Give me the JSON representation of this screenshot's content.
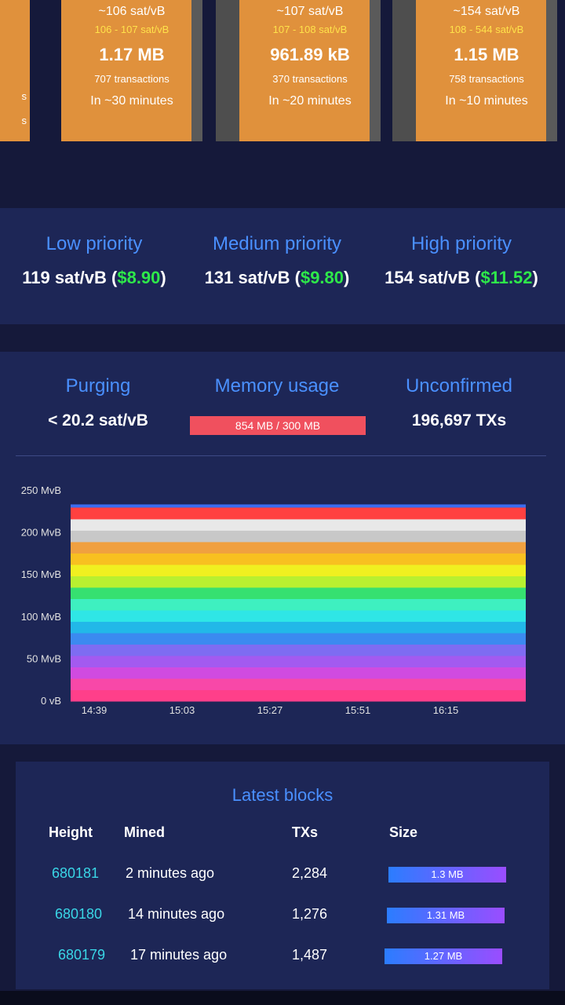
{
  "upcoming_blocks": {
    "edge_items": [
      "s",
      "s"
    ],
    "blocks": [
      {
        "fee": "~106 sat/vB",
        "range": "106 - 107 sat/vB",
        "size": "1.17 MB",
        "txs": "707 transactions",
        "eta": "In ~30 minutes"
      },
      {
        "fee": "~107 sat/vB",
        "range": "107 - 108 sat/vB",
        "size": "961.89 kB",
        "txs": "370 transactions",
        "eta": "In ~20 minutes"
      },
      {
        "fee": "~154 sat/vB",
        "range": "108 - 544 sat/vB",
        "size": "1.15 MB",
        "txs": "758 transactions",
        "eta": "In ~10 minutes"
      }
    ]
  },
  "fees": [
    {
      "title": "Low priority",
      "value": "119 sat/vB",
      "usd": "$8.90"
    },
    {
      "title": "Medium priority",
      "value": "131 sat/vB",
      "usd": "$9.80"
    },
    {
      "title": "High priority",
      "value": "154 sat/vB",
      "usd": "$11.52"
    }
  ],
  "mempool": {
    "purging": {
      "title": "Purging",
      "value": "< 20.2 sat/vB"
    },
    "memory": {
      "title": "Memory usage",
      "value": "854 MB / 300 MB"
    },
    "unconfirmed": {
      "title": "Unconfirmed",
      "value": "196,697 TXs"
    }
  },
  "chart_data": {
    "type": "area",
    "y_ticks": [
      "250 MvB",
      "200 MvB",
      "150 MvB",
      "100 MvB",
      "50 MvB",
      "0 vB"
    ],
    "x_ticks": [
      "14:39",
      "15:03",
      "15:27",
      "15:51",
      "16:15"
    ],
    "ylim": [
      0,
      250
    ],
    "stacked_total": 230,
    "band_colors": [
      "#ff3f8a",
      "#f848a8",
      "#d04be0",
      "#a35af0",
      "#7e6cf2",
      "#3b8af0",
      "#22b8e8",
      "#2fe6e6",
      "#3ef0c0",
      "#36e070",
      "#b8f030",
      "#f0f020",
      "#f8c020",
      "#f0a040",
      "#c8c8c8",
      "#e8e8e8",
      "#ff4040"
    ],
    "top_line_color": "#3a6cf0"
  },
  "latest_blocks": {
    "title": "Latest blocks",
    "headers": [
      "Height",
      "Mined",
      "TXs",
      "Size"
    ],
    "rows": [
      {
        "height": "680181",
        "mined": "2 minutes ago",
        "txs": "2,284",
        "size": "1.3 MB"
      },
      {
        "height": "680180",
        "mined": "14 minutes ago",
        "txs": "1,276",
        "size": "1.31 MB"
      },
      {
        "height": "680179",
        "mined": "17 minutes ago",
        "txs": "1,487",
        "size": "1.27 MB"
      }
    ]
  }
}
